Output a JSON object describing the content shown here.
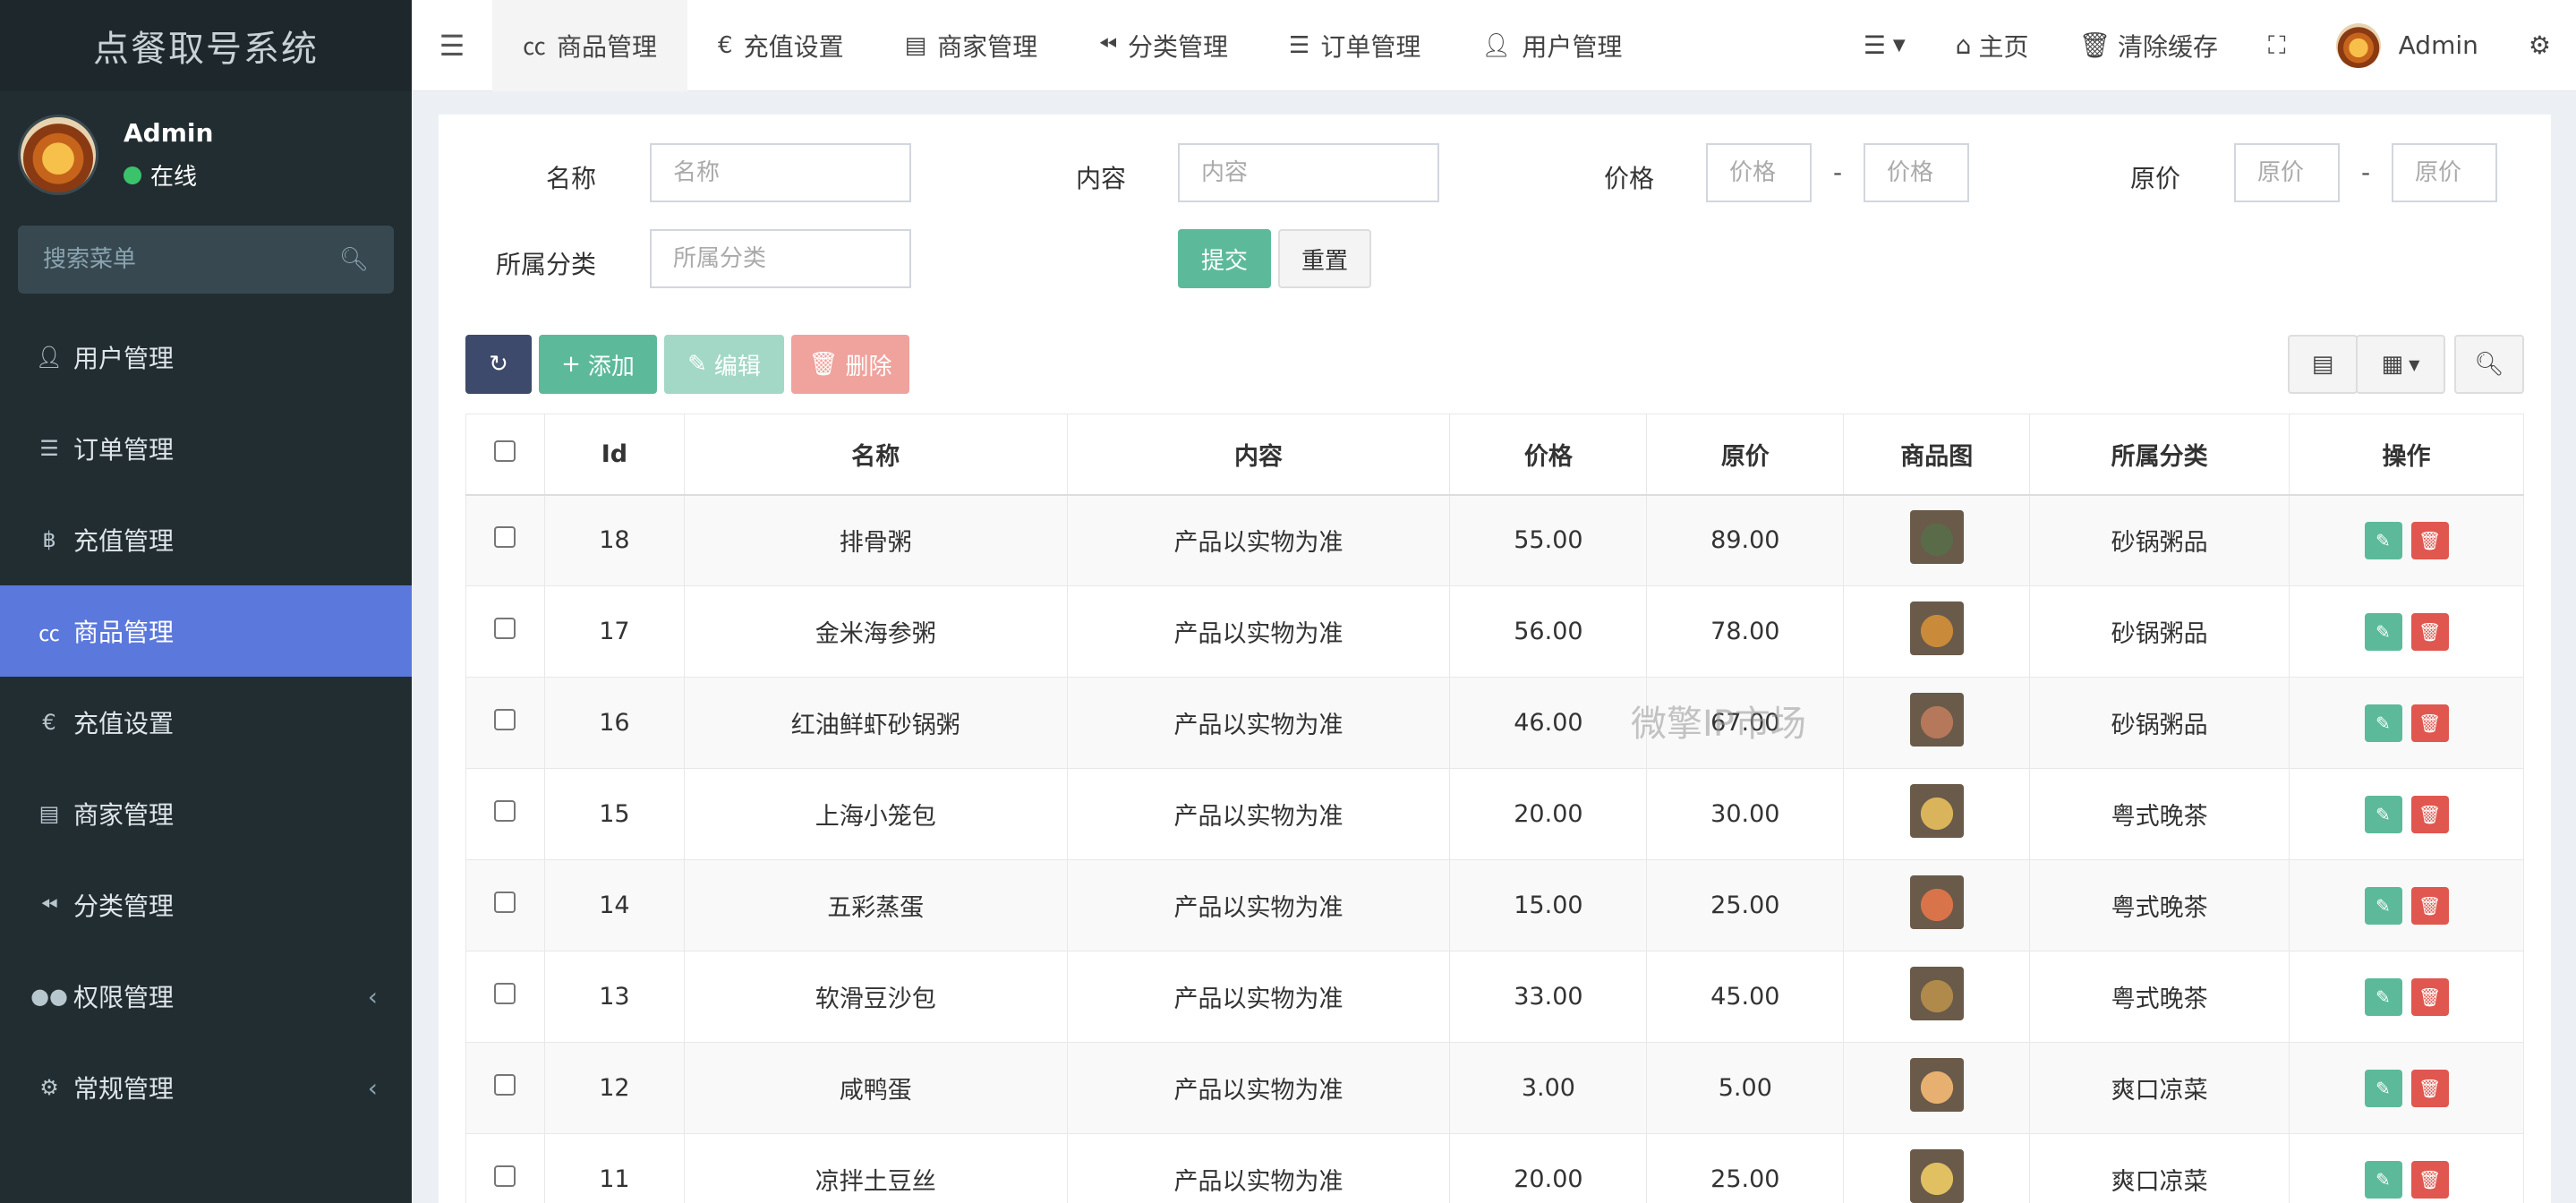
{
  "app": {
    "title": "点餐取号系统"
  },
  "user": {
    "name": "Admin",
    "status": "在线"
  },
  "sidebar": {
    "search_placeholder": "搜索菜单",
    "items": [
      {
        "label": "用户管理",
        "icon": "user-icon"
      },
      {
        "label": "订单管理",
        "icon": "list-icon"
      },
      {
        "label": "充值管理",
        "icon": "bitcoin-icon"
      },
      {
        "label": "商品管理",
        "icon": "cc-icon",
        "active": true
      },
      {
        "label": "充值设置",
        "icon": "euro-icon"
      },
      {
        "label": "商家管理",
        "icon": "address-book-icon"
      },
      {
        "label": "分类管理",
        "icon": "backward-icon"
      },
      {
        "label": "权限管理",
        "icon": "group-icon",
        "submenu": true
      },
      {
        "label": "常规管理",
        "icon": "gears-icon",
        "submenu": true
      }
    ]
  },
  "topbar": {
    "tabs": [
      {
        "label": "商品管理",
        "icon": "cc-icon",
        "active": true
      },
      {
        "label": "充值设置",
        "icon": "euro-icon"
      },
      {
        "label": "商家管理",
        "icon": "address-book-icon"
      },
      {
        "label": "分类管理",
        "icon": "backward-icon"
      },
      {
        "label": "订单管理",
        "icon": "list-icon"
      },
      {
        "label": "用户管理",
        "icon": "user-icon"
      }
    ],
    "home": "主页",
    "clear_cache": "清除缓存",
    "admin": "Admin"
  },
  "filters": {
    "name_label": "名称",
    "name_placeholder": "名称",
    "content_label": "内容",
    "content_placeholder": "内容",
    "price_label": "价格",
    "price_min_placeholder": "价格",
    "price_max_placeholder": "价格",
    "orig_label": "原价",
    "orig_min_placeholder": "原价",
    "orig_max_placeholder": "原价",
    "category_label": "所属分类",
    "category_placeholder": "所属分类",
    "dash": "-",
    "submit": "提交",
    "reset": "重置"
  },
  "toolbar": {
    "add": "添加",
    "edit": "编辑",
    "delete": "删除"
  },
  "table": {
    "columns": [
      "Id",
      "名称",
      "内容",
      "价格",
      "原价",
      "商品图",
      "所属分类",
      "操作"
    ],
    "rows": [
      {
        "id": "18",
        "name": "排骨粥",
        "content": "产品以实物为准",
        "price": "55.00",
        "orig": "89.00",
        "category": "砂锅粥品",
        "thumb": "#5a6b4a"
      },
      {
        "id": "17",
        "name": "金米海参粥",
        "content": "产品以实物为准",
        "price": "56.00",
        "orig": "78.00",
        "category": "砂锅粥品",
        "thumb": "#c98a3a"
      },
      {
        "id": "16",
        "name": "红油鲜虾砂锅粥",
        "content": "产品以实物为准",
        "price": "46.00",
        "orig": "67.00",
        "category": "砂锅粥品",
        "thumb": "#b5785a"
      },
      {
        "id": "15",
        "name": "上海小笼包",
        "content": "产品以实物为准",
        "price": "20.00",
        "orig": "30.00",
        "category": "粤式晚茶",
        "thumb": "#d9b45a"
      },
      {
        "id": "14",
        "name": "五彩蒸蛋",
        "content": "产品以实物为准",
        "price": "15.00",
        "orig": "25.00",
        "category": "粤式晚茶",
        "thumb": "#d9734a"
      },
      {
        "id": "13",
        "name": "软滑豆沙包",
        "content": "产品以实物为准",
        "price": "33.00",
        "orig": "45.00",
        "category": "粤式晚茶",
        "thumb": "#b08a4a"
      },
      {
        "id": "12",
        "name": "咸鸭蛋",
        "content": "产品以实物为准",
        "price": "3.00",
        "orig": "5.00",
        "category": "爽口凉菜",
        "thumb": "#e8b070"
      },
      {
        "id": "11",
        "name": "凉拌土豆丝",
        "content": "产品以实物为准",
        "price": "20.00",
        "orig": "25.00",
        "category": "爽口凉菜",
        "thumb": "#e0c060"
      }
    ]
  },
  "watermark": "微擎IP市场"
}
